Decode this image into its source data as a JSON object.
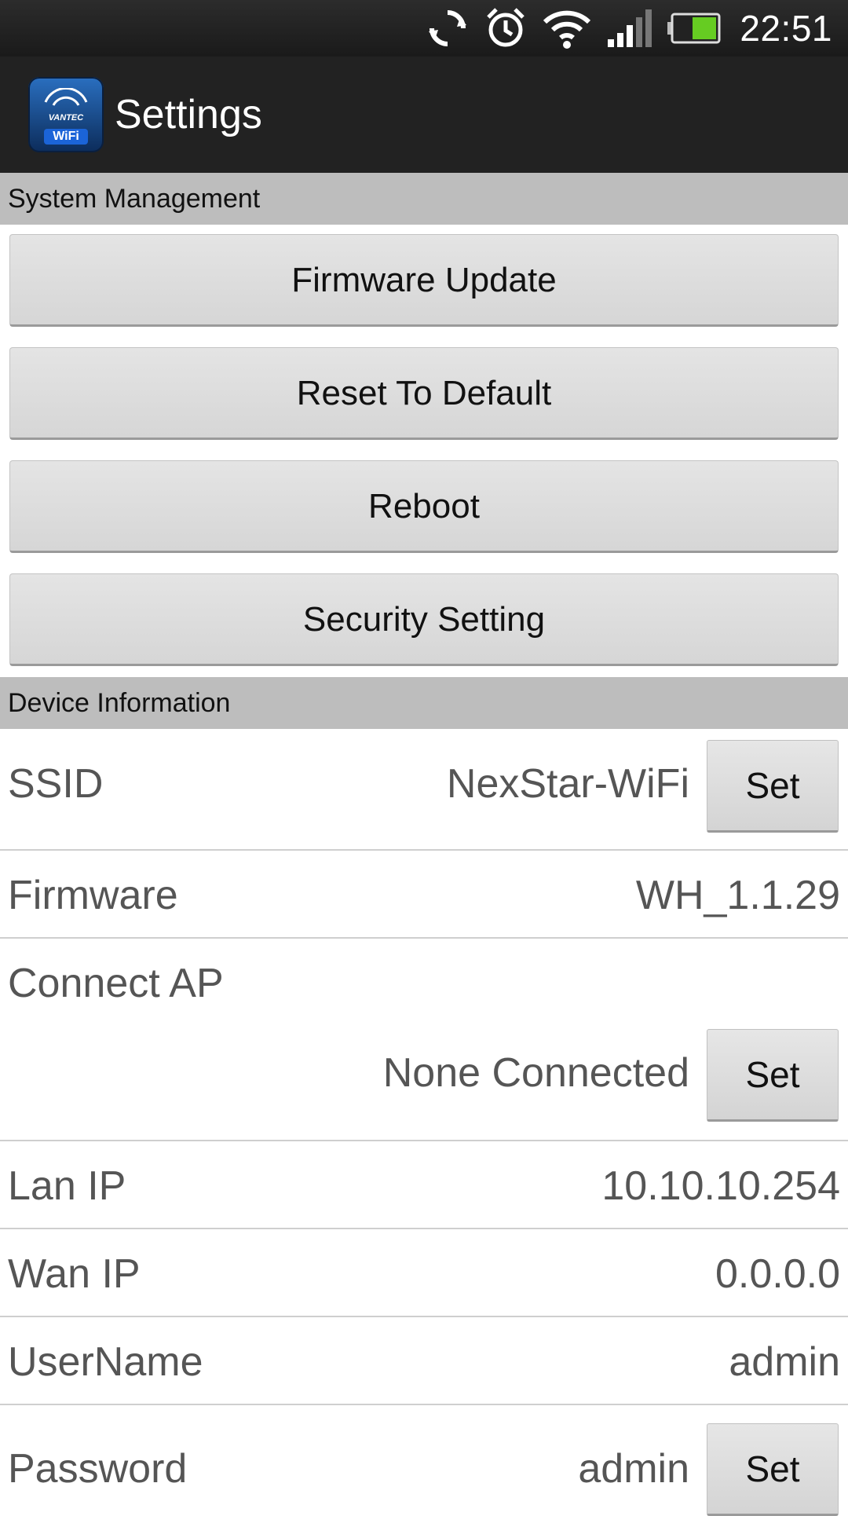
{
  "status_bar": {
    "time": "22:51",
    "icons": [
      "sync-icon",
      "alarm-icon",
      "wifi-icon",
      "signal-icon",
      "battery-icon"
    ]
  },
  "action_bar": {
    "logo_brand": "VANTEC",
    "logo_badge": "WiFi",
    "title": "Settings"
  },
  "system_management": {
    "header": "System Management",
    "buttons": [
      {
        "label": "Firmware Update"
      },
      {
        "label": "Reset To Default"
      },
      {
        "label": "Reboot"
      },
      {
        "label": "Security Setting"
      }
    ]
  },
  "device_information": {
    "header": "Device Information",
    "rows": [
      {
        "label": "SSID",
        "value": "NexStar-WiFi",
        "set_label": "Set"
      },
      {
        "label": "Firmware",
        "value": "WH_1.1.29"
      },
      {
        "label": "Connect AP",
        "value": "None Connected",
        "set_label": "Set"
      },
      {
        "label": "Lan IP",
        "value": "10.10.10.254"
      },
      {
        "label": "Wan IP",
        "value": "0.0.0.0"
      },
      {
        "label": "UserName",
        "value": "admin"
      },
      {
        "label": "Password",
        "value": "admin",
        "set_label": "Set"
      }
    ]
  },
  "colors": {
    "action_bar": "#222222",
    "section_header": "#bdbdbd",
    "battery_fill": "#66cc22"
  }
}
